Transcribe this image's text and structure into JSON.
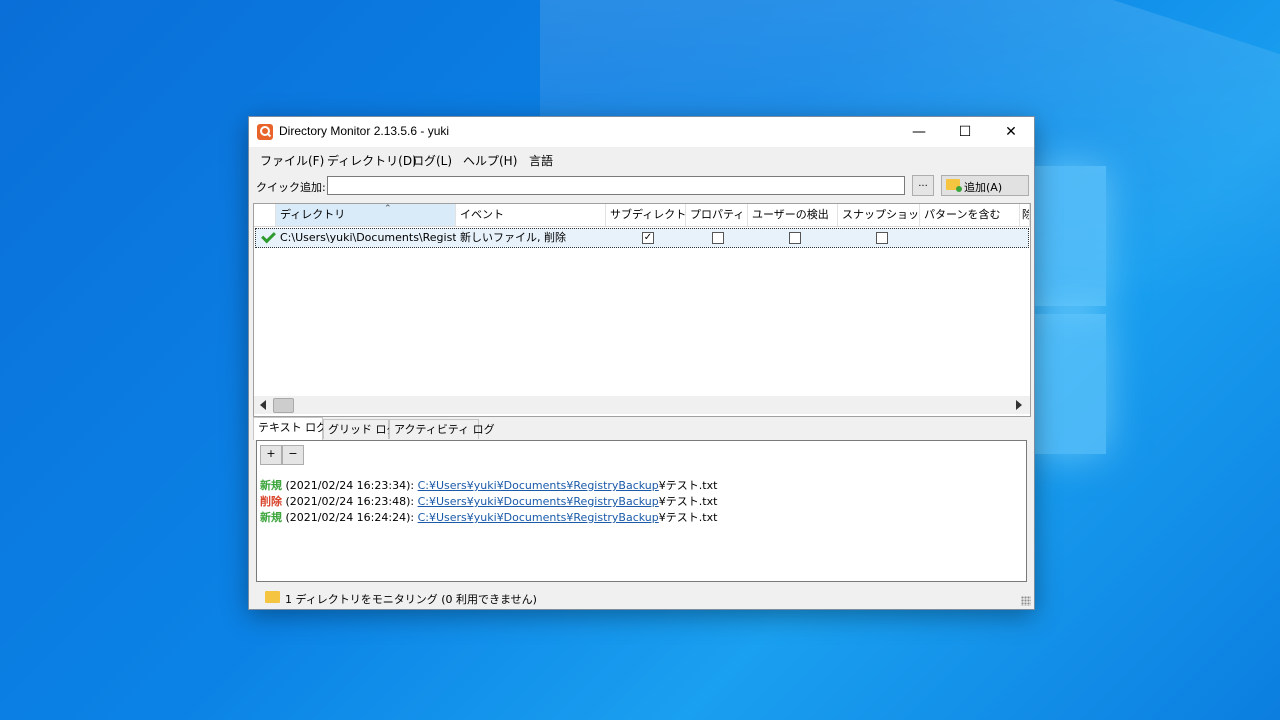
{
  "window": {
    "title": "Directory Monitor 2.13.5.6 - yuki",
    "controls": {
      "minimize": "—",
      "maximize": "☐",
      "close": "✕"
    }
  },
  "menu": [
    "ファイル(F)",
    "ディレクトリ(D)",
    "ログ(L)",
    "ヘルプ(H)",
    "言語"
  ],
  "quick_add": {
    "label": "クイック追加:",
    "value": "",
    "browse_label": "...",
    "add_label": "追加(A)"
  },
  "grid": {
    "columns": [
      "ディレクトリ",
      "イベント",
      "サブディレクトリ",
      "プロパティ",
      "ユーザーの検出",
      "スナップショット",
      "パターンを含む",
      "除"
    ],
    "rows": [
      {
        "directory": "C:\\Users\\yuki\\Documents\\Registry...",
        "events": "新しいファイル, 削除",
        "subdirectory": true,
        "properties": false,
        "user_detect": false,
        "snapshot": false
      }
    ]
  },
  "tabs": [
    "テキスト ログ",
    "グリッド ログ",
    "アクティビティ ログ"
  ],
  "active_tab": 0,
  "log": {
    "zoom_in": "+",
    "zoom_out": "−",
    "entries": [
      {
        "event": "新規",
        "type": "new",
        "time": " (2021/02/24 16:23:34): ",
        "path": "C:¥Users¥yuki¥Documents¥RegistryBackup",
        "file": "¥テスト.txt"
      },
      {
        "event": "削除",
        "type": "delete",
        "time": " (2021/02/24 16:23:48): ",
        "path": "C:¥Users¥yuki¥Documents¥RegistryBackup",
        "file": "¥テスト.txt"
      },
      {
        "event": "新規",
        "type": "new",
        "time": " (2021/02/24 16:24:24): ",
        "path": "C:¥Users¥yuki¥Documents¥RegistryBackup",
        "file": "¥テスト.txt"
      }
    ]
  },
  "status": {
    "text": "1 ディレクトリをモニタリング (0 利用できません)"
  },
  "colors": {
    "new": "#3ca53c",
    "delete": "#d9442c",
    "link": "#1a5aa8",
    "desktop": "#0b83e6"
  }
}
